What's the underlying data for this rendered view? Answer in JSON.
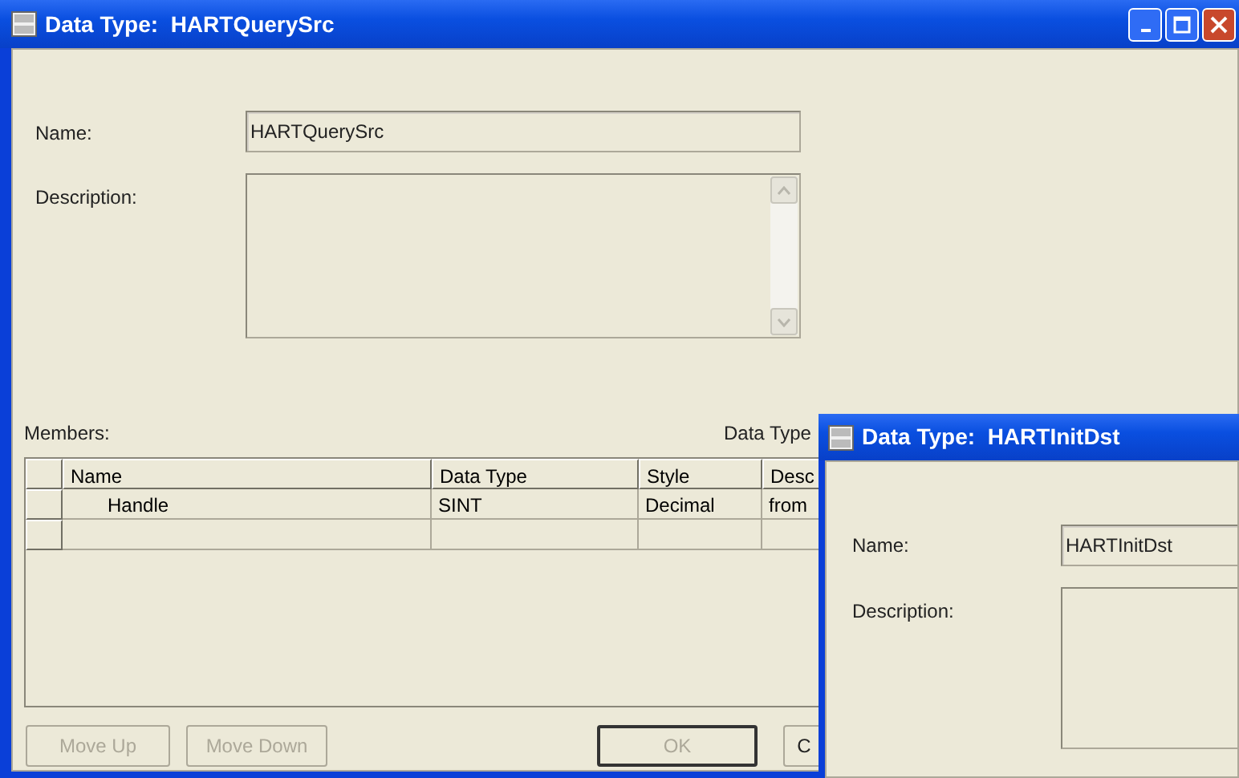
{
  "main_window": {
    "title": "Data Type:  HARTQuerySrc",
    "name_label": "Name:",
    "name_value": "HARTQuerySrc",
    "description_label": "Description:",
    "members_label": "Members:",
    "data_type_label": "Data Type",
    "table": {
      "columns": [
        "Name",
        "Data Type",
        "Style",
        "Desc"
      ],
      "rows": [
        {
          "cells": [
            "Handle",
            "SINT",
            "Decimal",
            "from"
          ]
        },
        {
          "cells": [
            "",
            "",
            "",
            ""
          ]
        }
      ]
    },
    "buttons": [
      {
        "label": "Move Up",
        "disabled": true,
        "default": false
      },
      {
        "label": "Move Down",
        "disabled": true,
        "default": false
      },
      {
        "label": "OK",
        "disabled": true,
        "default": true
      },
      {
        "label": "C",
        "disabled": false,
        "default": false
      }
    ]
  },
  "second_window": {
    "title": "Data Type:  HARTInitDst",
    "name_label": "Name:",
    "name_value": "HARTInitDst",
    "description_label": "Description:"
  }
}
